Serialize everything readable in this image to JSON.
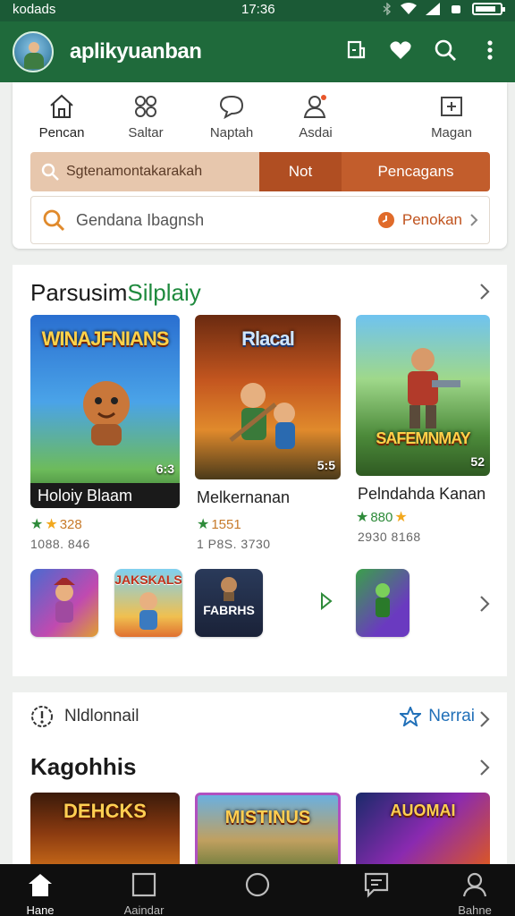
{
  "status": {
    "carrier": "kodads",
    "time": "17:36",
    "battery_level": 0.85
  },
  "app": {
    "name": "aplikyuanban",
    "actions": [
      "bookmark-icon",
      "heart-icon",
      "search-icon",
      "more-icon"
    ]
  },
  "categories": [
    {
      "label": "Pencan",
      "icon": "home-icon"
    },
    {
      "label": "Saltar",
      "icon": "grid-icon"
    },
    {
      "label": "Naptah",
      "icon": "chat-icon"
    },
    {
      "label": "Asdai",
      "icon": "user-icon"
    },
    {
      "label": "Magan",
      "icon": "plus-icon"
    }
  ],
  "filters": {
    "search_label": "Sgtenamontakarakah",
    "middle": "Not",
    "right": "Pencagans"
  },
  "searchbar": {
    "placeholder": "Gendana Ibagnsh",
    "action": "Penokan"
  },
  "section1": {
    "title": "Parsusim",
    "title_accent": "Silplaiy",
    "games": [
      {
        "art": "WINAJFNIANS",
        "name": "Holoiy Blaam",
        "badge": "6:3",
        "rating": "328",
        "meta": "1088. 846"
      },
      {
        "art": "Rlacal",
        "name": "Melkernanan",
        "badge": "5:5",
        "rating": "1551",
        "meta": "1 P8S. 3730"
      },
      {
        "art": "SAFEMNMAY",
        "name": "Pelndahda Kanan",
        "badge": "52",
        "rating": "880",
        "meta": "2930 8168"
      }
    ],
    "small_games": [
      {
        "title": ""
      },
      {
        "title": "JAKSKALS"
      },
      {
        "title": "FABRHS"
      },
      {
        "title": ""
      }
    ]
  },
  "section2": {
    "notify_label": "Nldlonnail",
    "new_label": "Nerrai",
    "title": "Kagohhis",
    "games": [
      {
        "art": "DEHCKS"
      },
      {
        "art": "MISTINUS"
      },
      {
        "art": "AUOMAI"
      }
    ]
  },
  "bottom_nav": [
    {
      "label": "Hane",
      "icon": "home-icon"
    },
    {
      "label": "Aaindar",
      "icon": "square-icon"
    },
    {
      "label": "",
      "icon": "circle-icon"
    },
    {
      "label": "",
      "icon": "message-icon"
    },
    {
      "label": "Bahne",
      "icon": "profile-icon"
    }
  ],
  "colors": {
    "appbar": "#1f6a3b",
    "accent": "#c25d2c",
    "green": "#1f8a3e"
  }
}
